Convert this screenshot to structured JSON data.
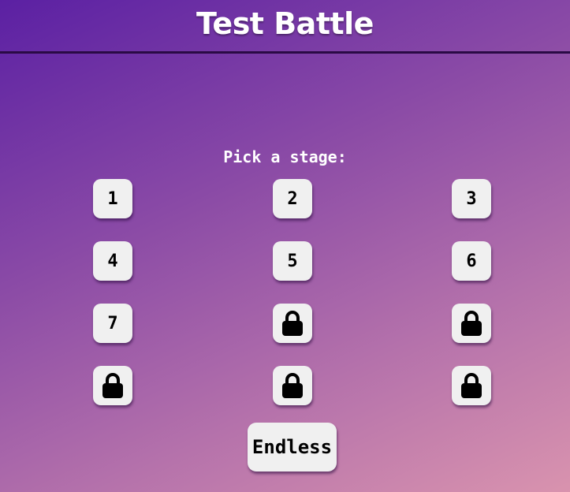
{
  "header": {
    "title": "Test Battle"
  },
  "prompt": "Pick a stage:",
  "stages": [
    {
      "label": "1",
      "locked": false
    },
    {
      "label": "2",
      "locked": false
    },
    {
      "label": "3",
      "locked": false
    },
    {
      "label": "4",
      "locked": false
    },
    {
      "label": "5",
      "locked": false
    },
    {
      "label": "6",
      "locked": false
    },
    {
      "label": "7",
      "locked": false
    },
    {
      "label": "",
      "icon": "lock-icon",
      "locked": true
    },
    {
      "label": "",
      "icon": "lock-icon",
      "locked": true
    },
    {
      "label": "",
      "icon": "lock-icon",
      "locked": true
    },
    {
      "label": "",
      "icon": "lock-icon",
      "locked": true
    },
    {
      "label": "",
      "icon": "lock-icon",
      "locked": true
    }
  ],
  "endless": {
    "label": "Endless"
  }
}
